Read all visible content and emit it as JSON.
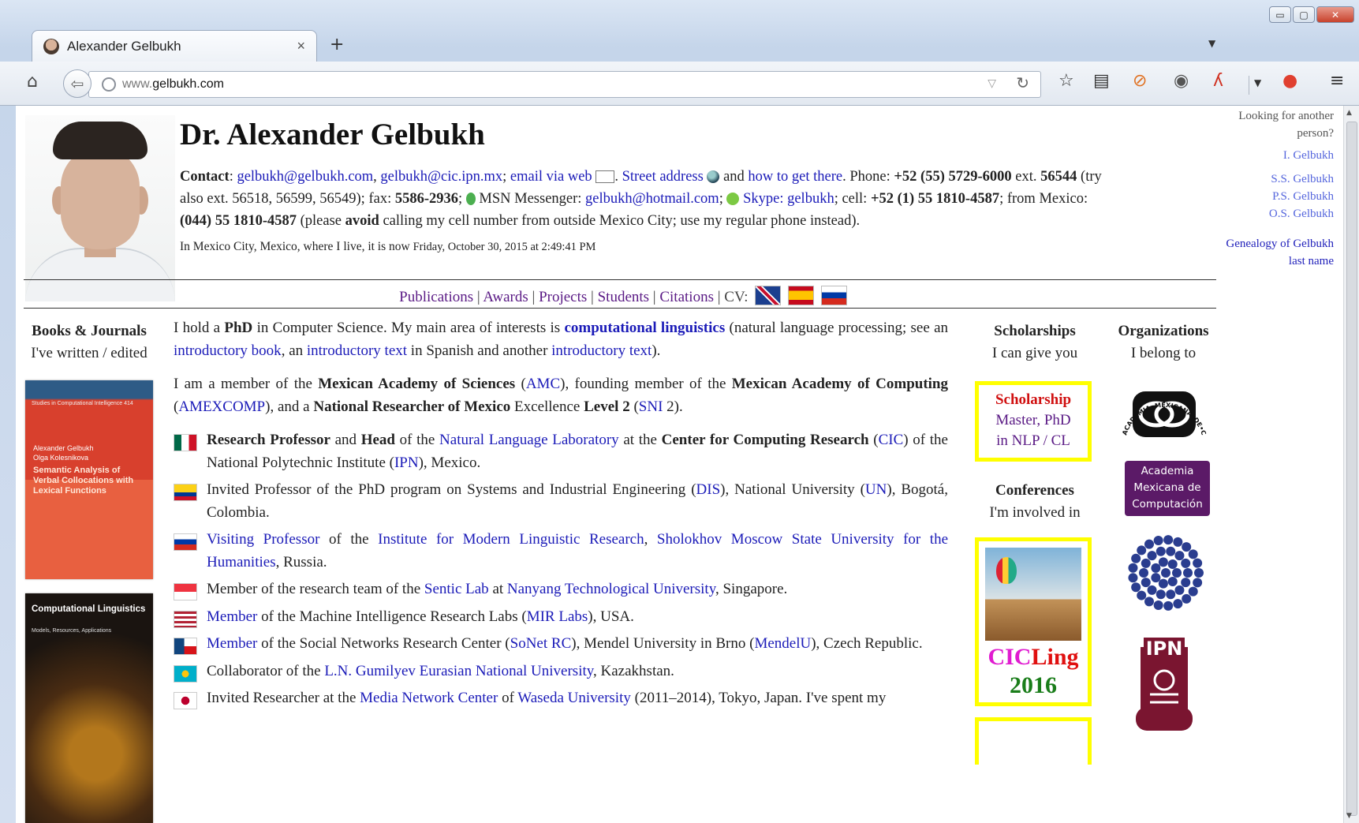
{
  "browser": {
    "tab_title": "Alexander Gelbukh",
    "tab_close": "×",
    "new_tab": "+",
    "url_prefix": "www.",
    "url_domain": "gelbukh.com",
    "window_controls": {
      "minimize": "▭",
      "maximize": "▢",
      "close": "✕"
    }
  },
  "header": {
    "name": "Dr. Alexander Gelbukh",
    "contact_label": "Contact",
    "email1": "gelbukh@gelbukh.com",
    "email2": "gelbukh@cic.ipn.mx",
    "email_web": "email via web",
    "street_address": "Street address",
    "how_to_get": "how to get there",
    "phone_label": "Phone:",
    "phone": "+52 (55) 5729-6000",
    "ext_label": "ext.",
    "ext": "56544",
    "ext_alt": "(try also ext. 56518, 56599, 56549); fax:",
    "fax": "5586-2936",
    "msn_label": "MSN Messenger:",
    "msn": "gelbukh@hotmail.com",
    "skype": "Skype: gelbukh",
    "cell_label": "; cell:",
    "cell": "+52 (1) 55 1810-4587",
    "from_mexico_label": "; from Mexico:",
    "from_mexico": "(044) 55 1810-4587",
    "please": "(please",
    "avoid": "avoid",
    "cell_note": "calling my cell number from outside Mexico City; use my regular phone instead).",
    "clock_label": "In Mexico City, Mexico, where I live, it is now",
    "clock_time": "Friday, October 30, 2015 at 2:49:41 PM"
  },
  "other_people": {
    "question": "Looking for another person?",
    "links": [
      "I. Gelbukh",
      "S.S. Gelbukh",
      "P.S. Gelbukh",
      "O.S. Gelbukh"
    ],
    "genealogy": "Genealogy of Gelbukh last name"
  },
  "menu": {
    "items": [
      "Publications",
      "Awards",
      "Projects",
      "Students",
      "Citations"
    ],
    "cv_label": "CV:"
  },
  "books": {
    "heading": "Books & Journals",
    "subheading": "I've written / edited",
    "book1_series": "Studies in Computational Intelligence  414",
    "book1_authors": "Alexander Gelbukh\nOlga Kolesnikova",
    "book1_title": "Semantic Analysis of Verbal Collocations with Lexical Functions",
    "book2_title": "Computational Linguistics",
    "book2_subtitle": "Models, Resources, Applications"
  },
  "main": {
    "p1_a": "I hold a",
    "p1_phd": "PhD",
    "p1_b": "in Computer Science. My main area of interests is",
    "p1_cl": "computational linguistics",
    "p1_c": "(natural language processing; see an",
    "p1_link1": "introductory book",
    "p1_d": ", an",
    "p1_link2": "introductory text",
    "p1_e": "in Spanish and another",
    "p1_link3": "introductory text",
    "p1_f": ").",
    "p2_a": "I am a member of the",
    "p2_mas": "Mexican Academy of Sciences",
    "p2_amc": "AMC",
    "p2_b": "), founding member of the",
    "p2_mac": "Mexican Academy of Computing",
    "p2_amexcomp": "AMEXCOMP",
    "p2_c": "), and a",
    "p2_nr": "National Researcher of Mexico",
    "p2_d": "Excellence",
    "p2_level": "Level 2",
    "p2_sni": "SNI",
    "p2_e": "2).",
    "roles": [
      {
        "flag": "mexico",
        "parts": [
          [
            "b",
            "Research Professor"
          ],
          [
            "t",
            " and "
          ],
          [
            "b",
            "Head"
          ],
          [
            "t",
            " of the "
          ],
          [
            "a",
            "Natural Language Laboratory"
          ],
          [
            "t",
            " at the "
          ],
          [
            "b",
            "Center for Computing Research"
          ],
          [
            "t",
            " ("
          ],
          [
            "a",
            "CIC"
          ],
          [
            "t",
            ") of the National Polytechnic Institute ("
          ],
          [
            "a",
            "IPN"
          ],
          [
            "t",
            "), Mexico."
          ]
        ]
      },
      {
        "flag": "colombia",
        "parts": [
          [
            "t",
            "Invited Professor of the PhD program on Systems and Industrial  Engineering ("
          ],
          [
            "a",
            "DIS"
          ],
          [
            "t",
            "), National University ("
          ],
          [
            "a",
            "UN"
          ],
          [
            "t",
            "), Bogotá, Colombia."
          ]
        ]
      },
      {
        "flag": "russia",
        "parts": [
          [
            "a",
            "Visiting Professor"
          ],
          [
            "t",
            " of the "
          ],
          [
            "a",
            "Institute for Modern Linguistic Research"
          ],
          [
            "t",
            ", "
          ],
          [
            "a",
            "Sholokhov Moscow State University for the Humanities"
          ],
          [
            "t",
            ", Russia."
          ]
        ]
      },
      {
        "flag": "singapore",
        "parts": [
          [
            "t",
            "Member of the research team of the "
          ],
          [
            "a",
            "Sentic Lab"
          ],
          [
            "t",
            " at "
          ],
          [
            "a",
            "Nanyang Technological University"
          ],
          [
            "t",
            ", Singapore."
          ]
        ]
      },
      {
        "flag": "usa",
        "parts": [
          [
            "a",
            "Member"
          ],
          [
            "t",
            " of the Machine Intelligence Research Labs ("
          ],
          [
            "a",
            "MIR Labs"
          ],
          [
            "t",
            "), USA."
          ]
        ]
      },
      {
        "flag": "czech",
        "parts": [
          [
            "a",
            "Member"
          ],
          [
            "t",
            " of the Social Networks Research Center ("
          ],
          [
            "a",
            "SoNet RC"
          ],
          [
            "t",
            "), Mendel University in Brno ("
          ],
          [
            "a",
            "MendelU"
          ],
          [
            "t",
            "), Czech Republic."
          ]
        ]
      },
      {
        "flag": "kazakhstan",
        "parts": [
          [
            "t",
            "Collaborator of the "
          ],
          [
            "a",
            "L.N. Gumilyev Eurasian National University"
          ],
          [
            "t",
            ", Kazakhstan."
          ]
        ]
      },
      {
        "flag": "japan",
        "parts": [
          [
            "t",
            "Invited Researcher at the "
          ],
          [
            "a",
            "Media Network Center"
          ],
          [
            "t",
            " of "
          ],
          [
            "a",
            "Waseda University"
          ],
          [
            "t",
            " (2011–2014), Tokyo, Japan. I've spent my"
          ]
        ]
      }
    ]
  },
  "scholarships": {
    "heading": "Scholarships",
    "subheading": "I can give you",
    "box_title": "Scholarship",
    "box_line2": "Master, PhD",
    "box_line3": "in NLP / CL"
  },
  "conferences": {
    "heading": "Conferences",
    "subheading": "I'm involved in",
    "cicling_ci": "CIC",
    "cicling_ling": "Ling",
    "cicling_year": "2016"
  },
  "organizations": {
    "heading": "Organizations",
    "subheading": "I belong to",
    "amc_ring_text": "ACADEMIA•MEXICANA•DE•CIENCIAS",
    "amexcomp": "Academia Mexicana de Computación",
    "ipn_text": "IPN"
  },
  "colors": {
    "link": "#1b1bb8",
    "menu_link": "#5a1a85",
    "highlight_box": "#ffff00",
    "amexcomp_bg": "#5b1a67"
  }
}
